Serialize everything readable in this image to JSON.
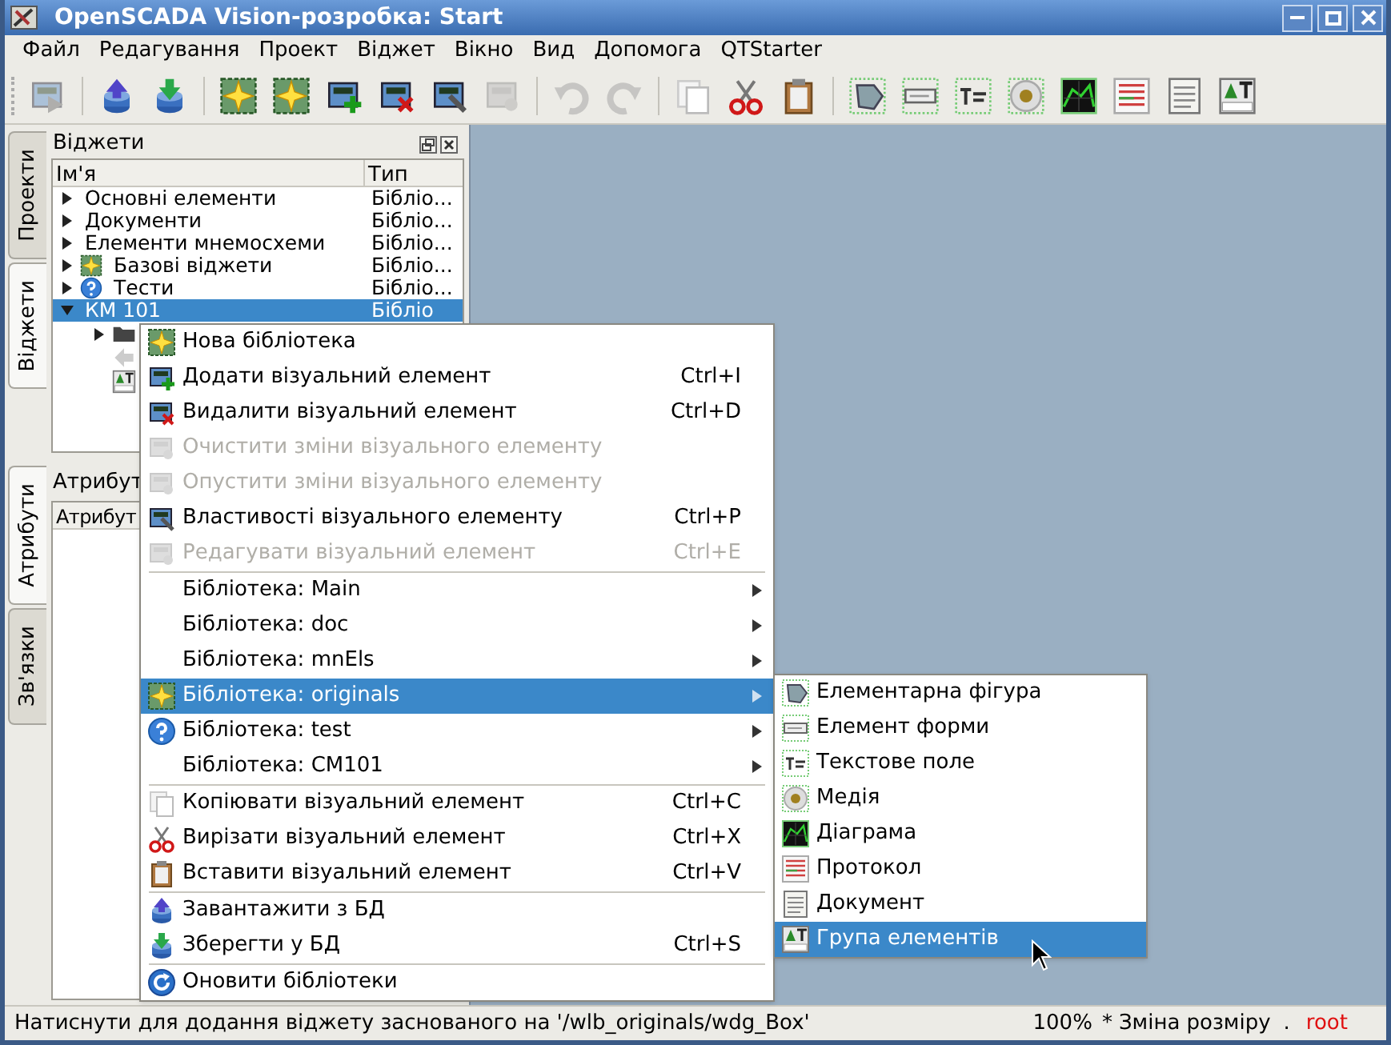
{
  "window": {
    "title": "OpenSCADA Vision-розробка: Start"
  },
  "menu_bar": [
    "Файл",
    "Редагування",
    "Проект",
    "Віджет",
    "Вікно",
    "Вид",
    "Допомога",
    "QTStarter"
  ],
  "toolbar": [
    [
      {
        "disabled": true
      }
    ],
    [
      {
        "disabled": false
      },
      {
        "disabled": false
      }
    ],
    [
      {
        "disabled": false
      },
      {
        "disabled": false
      },
      {
        "disabled": false
      },
      {
        "disabled": false
      },
      {
        "disabled": false
      },
      {
        "disabled": true
      }
    ],
    [
      {
        "disabled": true
      },
      {
        "disabled": true
      }
    ],
    [
      {
        "disabled": false
      },
      {
        "disabled": false
      },
      {
        "disabled": false
      }
    ],
    [
      {
        "disabled": false
      },
      {
        "disabled": false
      },
      {
        "disabled": false
      },
      {
        "disabled": false
      },
      {
        "disabled": false
      },
      {
        "disabled": false
      },
      {
        "disabled": false
      },
      {
        "disabled": false
      }
    ]
  ],
  "side_tabs_top": [
    {
      "label": "Проекти",
      "selected": false
    },
    {
      "label": "Віджети",
      "selected": true
    }
  ],
  "side_tabs_bottom": [
    {
      "label": "Атрибути",
      "selected": true
    },
    {
      "label": "Зв'язки",
      "selected": false
    }
  ],
  "widgets_dock": {
    "title": "Віджети",
    "columns": [
      "Ім'я",
      "Тип"
    ],
    "rows": [
      {
        "label": "Основні елементи",
        "type": "Бібліо...",
        "expanded": false,
        "selected": false
      },
      {
        "label": "Документи",
        "type": "Бібліо...",
        "expanded": false,
        "selected": false
      },
      {
        "label": "Елементи мнемосхеми",
        "type": "Бібліо...",
        "expanded": false,
        "selected": false
      },
      {
        "label": "Базові віджети",
        "type": "Бібліо...",
        "expanded": false,
        "selected": false
      },
      {
        "label": "Тести",
        "type": "Бібліо...",
        "expanded": false,
        "selected": false
      },
      {
        "label": "КМ 101",
        "type": "Бібліо",
        "expanded": true,
        "selected": true,
        "children": [
          {
            "expandable": true
          },
          {
            "expandable": false
          },
          {
            "expandable": false
          }
        ]
      }
    ]
  },
  "attributes_dock": {
    "title": "Атрибут",
    "columns": [
      "Атрибут"
    ]
  },
  "context_menu": [
    {
      "kind": "item",
      "label": "Нова бібліотека",
      "disabled": false,
      "selected": false
    },
    {
      "kind": "item",
      "label": "Додати візуальний елемент",
      "shortcut": "Ctrl+I",
      "disabled": false,
      "selected": false
    },
    {
      "kind": "item",
      "label": "Видалити візуальний елемент",
      "shortcut": "Ctrl+D",
      "disabled": false,
      "selected": false
    },
    {
      "kind": "item",
      "label": "Очистити зміни візуального елементу",
      "disabled": true,
      "selected": false
    },
    {
      "kind": "item",
      "label": "Опустити зміни візуального елементу",
      "disabled": true,
      "selected": false
    },
    {
      "kind": "item",
      "label": "Властивості візуального елементу",
      "shortcut": "Ctrl+P",
      "disabled": false,
      "selected": false
    },
    {
      "kind": "item",
      "label": "Редагувати візуальний елемент",
      "shortcut": "Ctrl+E",
      "disabled": true,
      "selected": false
    },
    {
      "kind": "separator"
    },
    {
      "kind": "submenu",
      "label": "Бібліотека: Main",
      "disabled": false,
      "selected": false
    },
    {
      "kind": "submenu",
      "label": "Бібліотека: doc",
      "disabled": false,
      "selected": false
    },
    {
      "kind": "submenu",
      "label": "Бібліотека: mnEls",
      "disabled": false,
      "selected": false
    },
    {
      "kind": "submenu",
      "label": "Бібліотека: originals",
      "disabled": false,
      "selected": true
    },
    {
      "kind": "submenu",
      "label": "Бібліотека: test",
      "disabled": false,
      "selected": false
    },
    {
      "kind": "submenu",
      "label": "Бібліотека: CM101",
      "disabled": false,
      "selected": false
    },
    {
      "kind": "separator"
    },
    {
      "kind": "item",
      "label": "Копіювати візуальний елемент",
      "shortcut": "Ctrl+C",
      "disabled": false,
      "selected": false
    },
    {
      "kind": "item",
      "label": "Вирізати візуальний елемент",
      "shortcut": "Ctrl+X",
      "disabled": false,
      "selected": false
    },
    {
      "kind": "item",
      "label": "Вставити візуальний елемент",
      "shortcut": "Ctrl+V",
      "disabled": false,
      "selected": false
    },
    {
      "kind": "separator"
    },
    {
      "kind": "item",
      "label": "Завантажити з БД",
      "disabled": false,
      "selected": false
    },
    {
      "kind": "item",
      "label": "Зберегти у БД",
      "shortcut": "Ctrl+S",
      "disabled": false,
      "selected": false
    },
    {
      "kind": "separator"
    },
    {
      "kind": "item",
      "label": "Оновити бібліотеки",
      "disabled": false,
      "selected": false
    }
  ],
  "submenu": [
    {
      "label": "Елементарна фігура",
      "selected": false
    },
    {
      "label": "Елемент форми",
      "selected": false
    },
    {
      "label": "Текстове поле",
      "selected": false
    },
    {
      "label": "Медія",
      "selected": false
    },
    {
      "label": "Діаграма",
      "selected": false
    },
    {
      "label": "Протокол",
      "selected": false
    },
    {
      "label": "Документ",
      "selected": false
    },
    {
      "label": "Група елементів",
      "selected": true
    }
  ],
  "status_bar": {
    "message": "Натиснути для додання віджету заснованого на '/wlb_originals/wdg_Box'",
    "zoom": "100%",
    "modified": "*",
    "mode": "Зміна розміру",
    "separator": ".",
    "user": "root"
  }
}
